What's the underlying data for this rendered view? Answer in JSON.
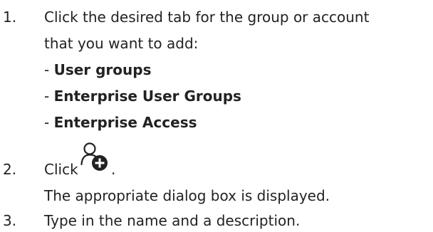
{
  "steps": [
    {
      "number": "1.",
      "line1": "Click the desired tab for the group or account",
      "line2": "that you want to add:",
      "options": [
        {
          "dash": "- ",
          "label": "User groups"
        },
        {
          "dash": "- ",
          "label": "Enterprise User Groups"
        },
        {
          "dash": "- ",
          "label": "Enterprise Access"
        }
      ]
    },
    {
      "number": "2.",
      "prefix": "Click",
      "suffix": ".",
      "icon": "add-user-icon",
      "result": "The appropriate dialog box is displayed."
    },
    {
      "number": "3.",
      "text": "Type in the name and a description."
    }
  ]
}
